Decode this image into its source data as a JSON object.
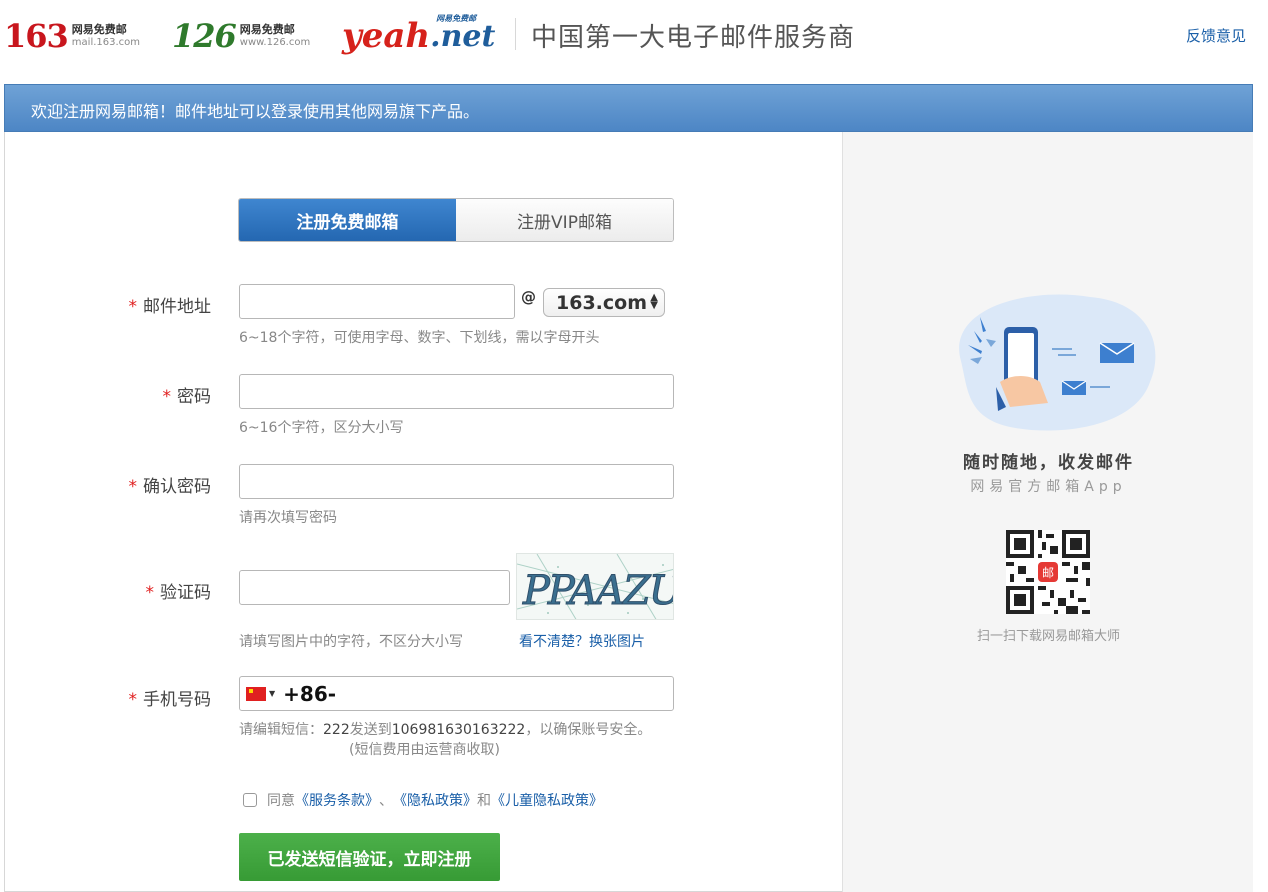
{
  "header": {
    "logo_163": {
      "num": "163",
      "line1": "网易免费邮",
      "line2": "mail.163.com"
    },
    "logo_126": {
      "num": "126",
      "line1": "网易免费邮",
      "line2": "www.126.com"
    },
    "logo_yeah": {
      "word": "yeah",
      "dot_net": ".net",
      "tag": "网易免费邮"
    },
    "slogan": "中国第一大电子邮件服务商",
    "feedback": "反馈意见"
  },
  "banner": {
    "text": "欢迎注册网易邮箱！邮件地址可以登录使用其他网易旗下产品。"
  },
  "tabs": [
    {
      "label": "注册免费邮箱",
      "active": true
    },
    {
      "label": "注册VIP邮箱",
      "active": false
    }
  ],
  "form": {
    "required_mark": "*",
    "email": {
      "label": "邮件地址",
      "value": "",
      "at": "@",
      "domain": "163.com",
      "hint": "6~18个字符，可使用字母、数字、下划线，需以字母开头"
    },
    "password": {
      "label": "密码",
      "value": "",
      "hint": "6~16个字符，区分大小写"
    },
    "confirm": {
      "label": "确认密码",
      "value": "",
      "hint": "请再次填写密码"
    },
    "captcha": {
      "label": "验证码",
      "value": "",
      "image_text": "PPAAZU",
      "hint": "请填写图片中的字符，不区分大小写",
      "refresh": "看不清楚？换张图片"
    },
    "phone": {
      "label": "手机号码",
      "country_code": "+86-",
      "flag_icon": "cn-flag-icon",
      "sms_prefix": "请编辑短信：",
      "sms_code": "222",
      "sms_mid": "发送到",
      "sms_number": "106981630163222",
      "sms_suffix": "，以确保账号安全。",
      "sms_note": "(短信费用由运营商收取)"
    },
    "agree": {
      "prefix": "同意",
      "terms": "《服务条款》",
      "sep": "、",
      "privacy": "《隐私政策》",
      "and": "和",
      "child_privacy": "《儿童隐私政策》",
      "checked": false
    },
    "submit": "已发送短信验证，立即注册"
  },
  "sidebar": {
    "title": "随时随地，收发邮件",
    "subtitle": "网易官方邮箱App",
    "qr_badge": "邮",
    "qr_caption": "扫一扫下载网易邮箱大师"
  },
  "colors": {
    "brand_blue": "#4d86c5",
    "link": "#1a5fa8",
    "required": "#e02020",
    "submit": "#379b35"
  }
}
